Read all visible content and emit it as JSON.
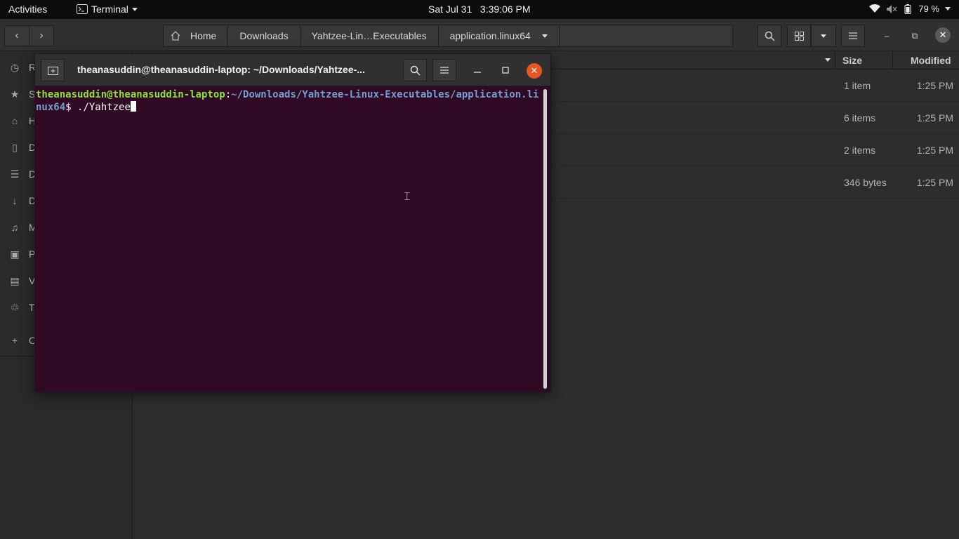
{
  "topbar": {
    "activities": "Activities",
    "app_name": "Terminal",
    "clock": "Sat Jul 31   3:39:06 PM",
    "battery": "79 %"
  },
  "files": {
    "path": [
      "Home",
      "Downloads",
      "Yahtzee-Lin…Executables",
      "application.linux64"
    ],
    "sidebar": [
      {
        "icon": "clock-icon",
        "label": "Re"
      },
      {
        "icon": "star-icon",
        "label": "St"
      },
      {
        "icon": "home-icon",
        "label": "H"
      },
      {
        "icon": "desktop-icon",
        "label": "D"
      },
      {
        "icon": "document-icon",
        "label": "D"
      },
      {
        "icon": "download-icon",
        "label": "D"
      },
      {
        "icon": "music-icon",
        "label": "M"
      },
      {
        "icon": "picture-icon",
        "label": "Pi"
      },
      {
        "icon": "video-icon",
        "label": "V"
      },
      {
        "icon": "trash-icon",
        "label": "Tr"
      },
      {
        "icon": "plus-icon",
        "label": "O"
      }
    ],
    "columns": {
      "size": "Size",
      "modified": "Modified"
    },
    "rows": [
      {
        "size": "1 item",
        "modified": "1:25 PM"
      },
      {
        "size": "6 items",
        "modified": "1:25 PM"
      },
      {
        "size": "2 items",
        "modified": "1:25 PM"
      },
      {
        "size": "346 bytes",
        "modified": "1:25 PM"
      }
    ]
  },
  "terminal": {
    "title": "theanasuddin@theanasuddin-laptop: ~/Downloads/Yahtzee-...",
    "prompt_user": "theanasuddin@theanasuddin-laptop",
    "prompt_sep": ":",
    "prompt_path": "~/Downloads/Yahtzee-Linux-Executables/application.linux64",
    "prompt_dollar": "$ ",
    "command": "./Yahtzee"
  },
  "colors": {
    "terminal_bg": "#300a24",
    "prompt_user": "#8ae234",
    "prompt_path": "#729fcf",
    "close_button": "#e95420"
  }
}
